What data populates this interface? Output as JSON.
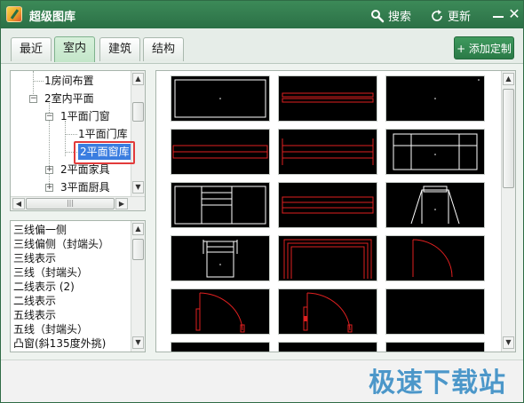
{
  "window": {
    "title": "超级图库"
  },
  "titlebar": {
    "search_label": "搜索",
    "refresh_label": "更新",
    "close_glyph": "✕"
  },
  "tabs": [
    {
      "label": "最近",
      "active": false
    },
    {
      "label": "室内",
      "active": true
    },
    {
      "label": "建筑",
      "active": false
    },
    {
      "label": "结构",
      "active": false
    }
  ],
  "add_button": {
    "label": "+ 添加定制"
  },
  "tree": {
    "nodes": [
      {
        "label": "1房间布置",
        "level": 2,
        "expander": ""
      },
      {
        "label": "2室内平面",
        "level": 1,
        "expander": "−"
      },
      {
        "label": "1平面门窗",
        "level": 2,
        "expander": "−"
      },
      {
        "label": "1平面门库",
        "level": 3,
        "expander": ""
      },
      {
        "label": "2平面窗库",
        "level": 3,
        "expander": "",
        "selected": true
      },
      {
        "label": "2平面家具",
        "level": 2,
        "expander": "+"
      },
      {
        "label": "3平面厨具",
        "level": 2,
        "expander": "+"
      }
    ]
  },
  "list": {
    "items": [
      "三线偏一侧",
      "三线偏侧（封端头）",
      "三线表示",
      "三线（封端头）",
      "二线表示 (2)",
      "二线表示",
      "五线表示",
      "五线（封端头）",
      "凸窗(斜135度外挑)"
    ]
  },
  "grid": {
    "thumbnails": [
      {
        "kind": "plain-white"
      },
      {
        "kind": "red-bars"
      },
      {
        "kind": "dot-only"
      },
      {
        "kind": "red-long"
      },
      {
        "kind": "red-long-ticks"
      },
      {
        "kind": "white-grid"
      },
      {
        "kind": "white-grid-2"
      },
      {
        "kind": "red-bars-2"
      },
      {
        "kind": "bay-window"
      },
      {
        "kind": "white-box"
      },
      {
        "kind": "red-frame"
      },
      {
        "kind": "red-arc"
      },
      {
        "kind": "red-door-arc"
      },
      {
        "kind": "red-door-arc-2"
      },
      {
        "kind": "blank"
      }
    ]
  },
  "watermark": {
    "text": "极速下载站"
  },
  "colors": {
    "titlebar": "#2f7a4c",
    "accent": "#2a7a47",
    "cad_red": "#e02020",
    "selection": "#3a7de0"
  }
}
